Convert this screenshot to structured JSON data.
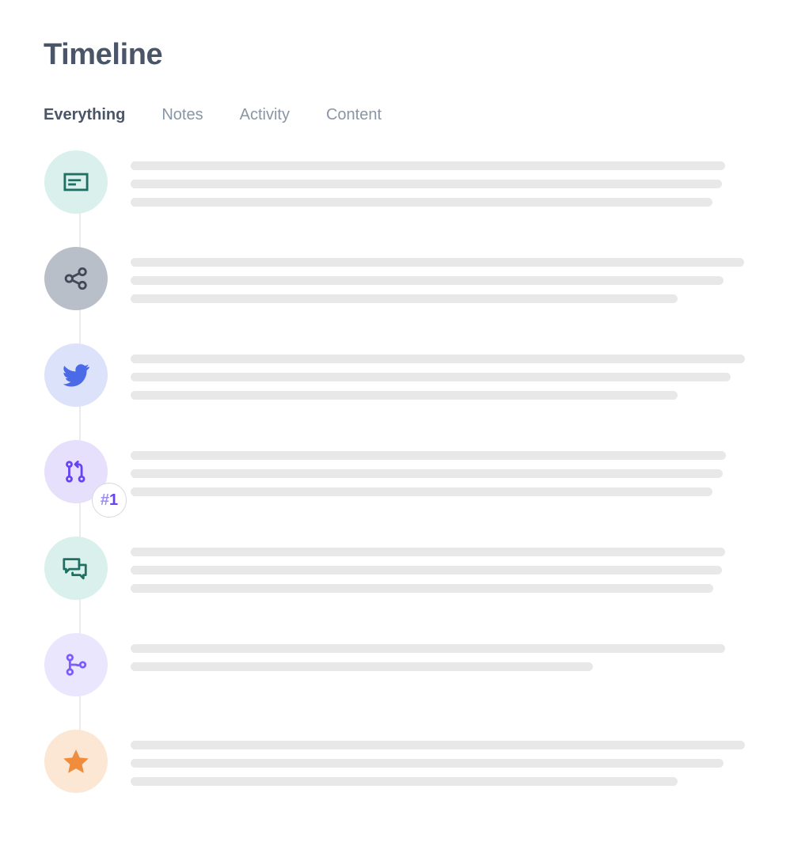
{
  "header": {
    "title": "Timeline"
  },
  "tabs": [
    {
      "label": "Everything",
      "active": true
    },
    {
      "label": "Notes",
      "active": false
    },
    {
      "label": "Activity",
      "active": false
    },
    {
      "label": "Content",
      "active": false
    }
  ],
  "colors": {
    "title": "#4a5568",
    "tab_active": "#4a5568",
    "tab_inactive": "#8a96a3",
    "skeleton": "#e8e8e8",
    "connector": "#ebebeb",
    "badge_hash": "#9b8bfb",
    "badge_number": "#6644f5"
  },
  "timeline": {
    "items": [
      {
        "icon": "note-card-icon",
        "circle_bg": "#d9f0ec",
        "icon_color": "#1f6f63",
        "badge": null,
        "lines": [
          751,
          747,
          735
        ]
      },
      {
        "icon": "share-icon",
        "circle_bg": "#b8bfc9",
        "icon_color": "#414a56",
        "badge": null,
        "lines": [
          775,
          749,
          691
        ]
      },
      {
        "icon": "twitter-bird-icon",
        "circle_bg": "#dbe2fa",
        "icon_color": "#4a6ae8",
        "badge": null,
        "lines": [
          776,
          758,
          691
        ]
      },
      {
        "icon": "git-pull-request-icon",
        "circle_bg": "#e6e0fc",
        "icon_color": "#6644f5",
        "badge": {
          "hash": "#",
          "number": "1"
        },
        "lines": [
          752,
          748,
          735
        ]
      },
      {
        "icon": "comments-icon",
        "circle_bg": "#d9f0ec",
        "icon_color": "#1f6f63",
        "badge": null,
        "lines": [
          751,
          747,
          736
        ]
      },
      {
        "icon": "git-branch-icon",
        "circle_bg": "#eae6fd",
        "icon_color": "#7c5cfa",
        "badge": null,
        "lines": [
          751,
          584
        ]
      },
      {
        "icon": "star-icon",
        "circle_bg": "#fce7d4",
        "icon_color": "#ef8d3c",
        "badge": null,
        "lines": [
          776,
          749,
          691
        ]
      }
    ]
  }
}
